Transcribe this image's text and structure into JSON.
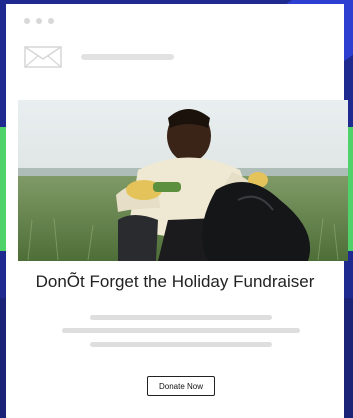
{
  "email": {
    "title": "DonÕt Forget the Holiday Fundraiser",
    "button_label": "Donate Now",
    "icons": {
      "window_dots": "window-dots-icon",
      "mail": "mail-icon"
    }
  },
  "colors": {
    "background": "#1e2a8f",
    "accent_green": "#4fd26a",
    "card": "#ffffff",
    "placeholder_lines": "#dedede"
  }
}
